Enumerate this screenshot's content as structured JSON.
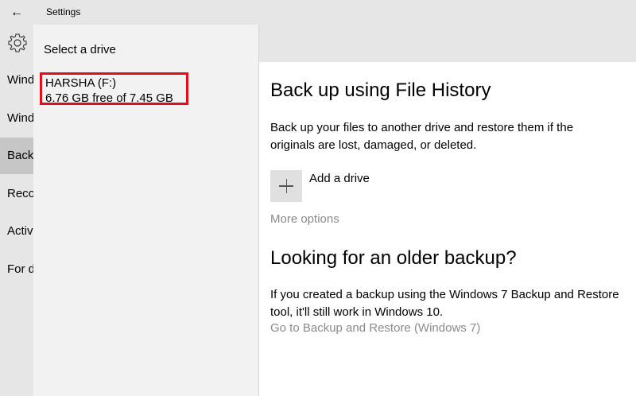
{
  "titlebar": {
    "title": "Settings",
    "back_icon": "←"
  },
  "leftnav": {
    "items": [
      {
        "label": "Windows Update"
      },
      {
        "label": "Windows Defender"
      },
      {
        "label": "Backup",
        "active": true
      },
      {
        "label": "Recovery"
      },
      {
        "label": "Activation"
      },
      {
        "label": "For developers"
      }
    ]
  },
  "flyout": {
    "heading": "Select a drive",
    "drive": {
      "name": "HARSHA (F:)",
      "free": "6.76 GB free of 7.45 GB"
    }
  },
  "main": {
    "title": "Back up using File History",
    "description": "Back up your files to another drive and restore them if the originals are lost, damaged, or deleted.",
    "add_drive": "Add a drive",
    "more_options": "More options",
    "older_title": "Looking for an older backup?",
    "older_description": "If you created a backup using the Windows 7 Backup and Restore tool, it'll still work in Windows 10.",
    "restore_link": "Go to Backup and Restore (Windows 7)"
  },
  "colors": {
    "highlight_border": "#e0101a",
    "link_gray": "#8a8a8a",
    "nav_bg": "#e6e6e6"
  }
}
